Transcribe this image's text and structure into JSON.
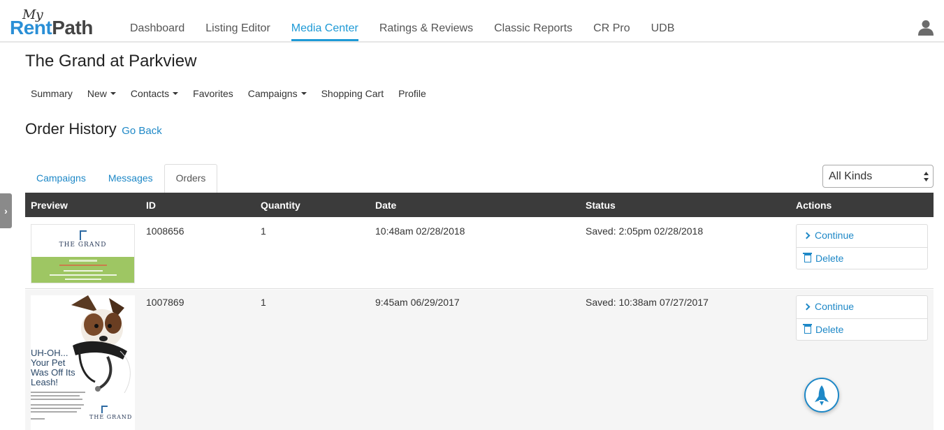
{
  "logo": {
    "my": "My",
    "rent": "Rent",
    "path": "Path"
  },
  "nav": {
    "items": [
      {
        "label": "Dashboard",
        "active": false
      },
      {
        "label": "Listing Editor",
        "active": false
      },
      {
        "label": "Media Center",
        "active": true
      },
      {
        "label": "Ratings & Reviews",
        "active": false
      },
      {
        "label": "Classic Reports",
        "active": false
      },
      {
        "label": "CR Pro",
        "active": false
      },
      {
        "label": "UDB",
        "active": false
      }
    ],
    "user_icon": "user-icon"
  },
  "property_title": "The Grand at Parkview",
  "subnav": [
    {
      "label": "Summary",
      "dropdown": false
    },
    {
      "label": "New",
      "dropdown": true
    },
    {
      "label": "Contacts",
      "dropdown": true
    },
    {
      "label": "Favorites",
      "dropdown": false
    },
    {
      "label": "Campaigns",
      "dropdown": true
    },
    {
      "label": "Shopping Cart",
      "dropdown": false
    },
    {
      "label": "Profile",
      "dropdown": false
    }
  ],
  "page": {
    "heading": "Order History",
    "back_link": "Go Back"
  },
  "tabs": [
    {
      "label": "Campaigns",
      "active": false
    },
    {
      "label": "Messages",
      "active": false
    },
    {
      "label": "Orders",
      "active": true
    }
  ],
  "kind_filter": {
    "selected": "All Kinds"
  },
  "table": {
    "headers": [
      "Preview",
      "ID",
      "Quantity",
      "Date",
      "Status",
      "Actions"
    ],
    "rows": [
      {
        "preview": {
          "brand": "THE GRAND"
        },
        "id": "1008656",
        "quantity": "1",
        "date": "10:48am 02/28/2018",
        "status": "Saved: 2:05pm 02/28/2018",
        "continue_label": "Continue",
        "delete_label": "Delete"
      },
      {
        "preview": {
          "headline": "UH-OH... Your Pet Was Off Its Leash!",
          "brand": "THE GRAND"
        },
        "id": "1007869",
        "quantity": "1",
        "date": "9:45am 06/29/2017",
        "status": "Saved: 10:38am 07/27/2017",
        "continue_label": "Continue",
        "delete_label": "Delete"
      }
    ]
  },
  "colors": {
    "accent": "#1e9ad6",
    "link": "#1e88c7",
    "table_header": "#3b3b3b",
    "thumb_green": "#9ec663"
  }
}
